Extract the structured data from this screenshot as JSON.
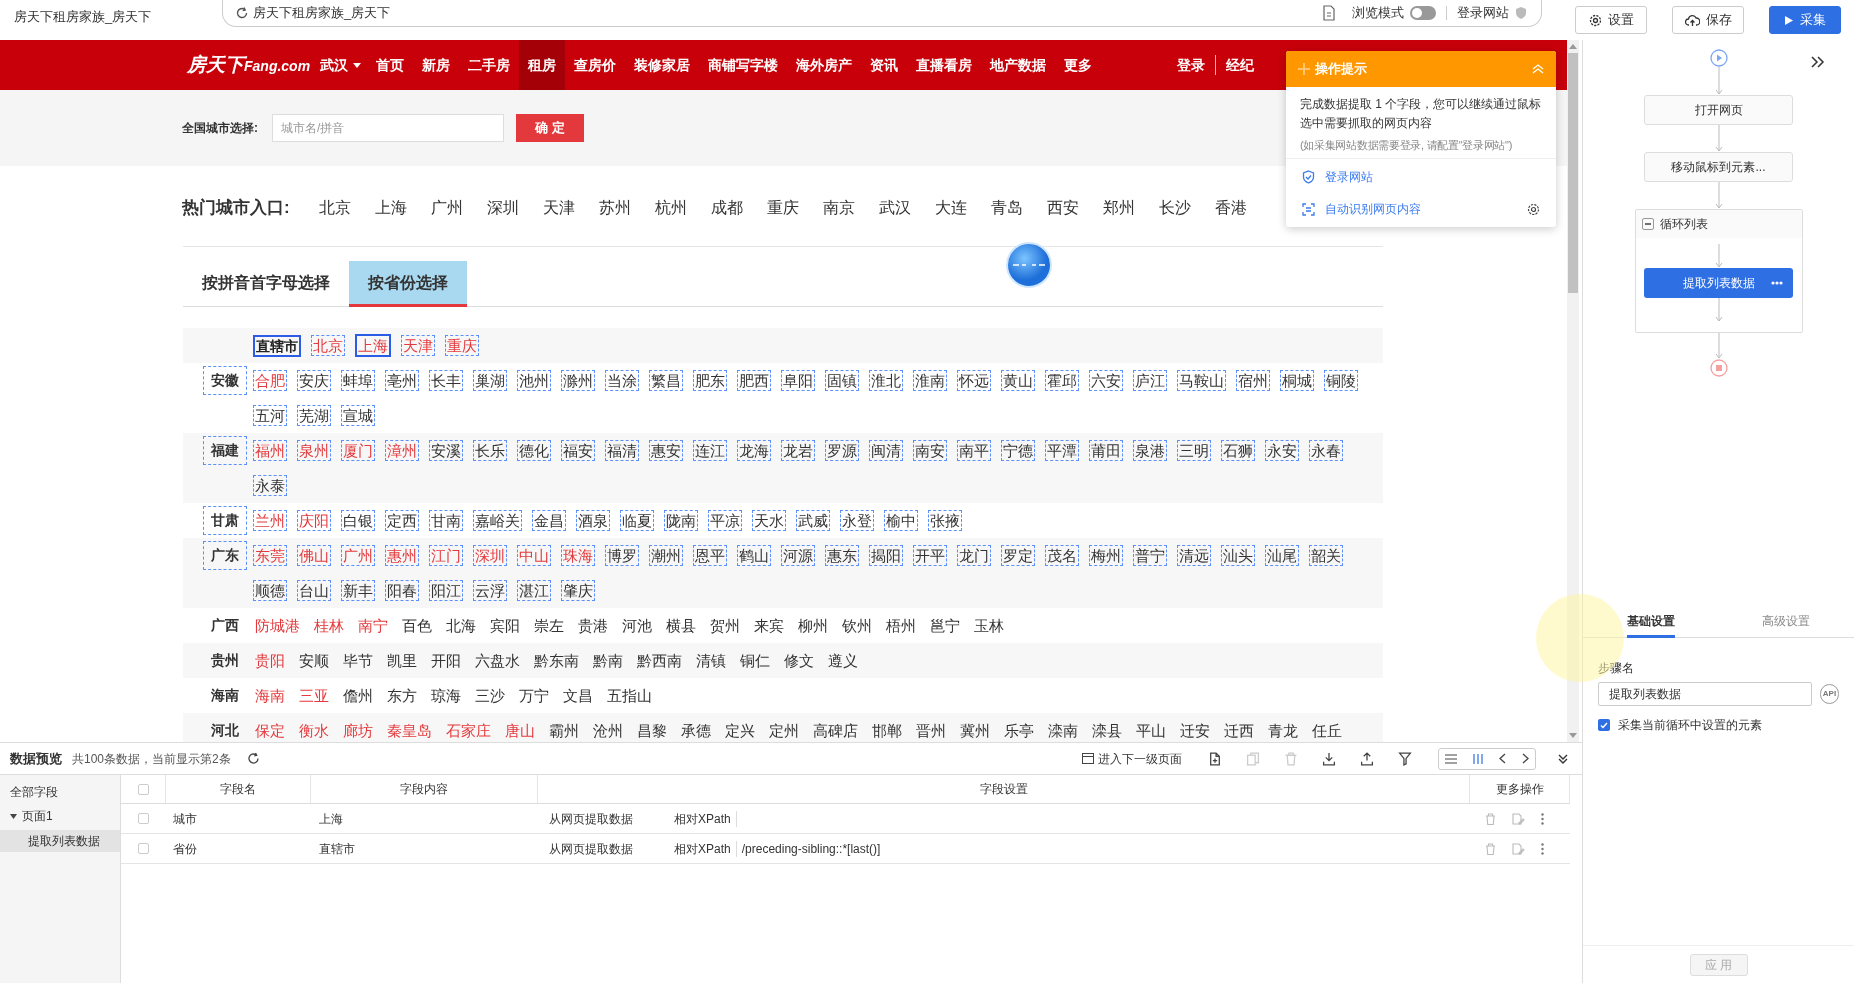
{
  "window": {
    "title": "房天下租房家族_房天下"
  },
  "address_bar": {
    "value": "房天下租房家族_房天下",
    "browse_mode": {
      "label": "浏览模式",
      "on": false
    },
    "login_label": "登录网站"
  },
  "toolbar_buttons": [
    {
      "label": "设置",
      "kind": "settings"
    },
    {
      "label": "保存",
      "kind": "save"
    },
    {
      "label": "采集",
      "kind": "collect"
    }
  ],
  "site": {
    "logo": "房天下",
    "logo_suffix": "Fang.com",
    "city": "武汉",
    "nav": [
      {
        "label": "首页",
        "selected": false
      },
      {
        "label": "新房",
        "selected": false
      },
      {
        "label": "二手房",
        "selected": false
      },
      {
        "label": "租房",
        "selected": true
      },
      {
        "label": "查房价",
        "selected": false
      },
      {
        "label": "装修家居",
        "selected": false
      },
      {
        "label": "商铺写字楼",
        "selected": false
      },
      {
        "label": "海外房产",
        "selected": false
      },
      {
        "label": "资讯",
        "selected": false
      },
      {
        "label": "直播看房",
        "selected": false
      },
      {
        "label": "地产数据",
        "selected": false
      },
      {
        "label": "更多",
        "selected": false
      }
    ],
    "login": "登录",
    "agent": "经纪",
    "city_search": {
      "label": "全国城市选择:",
      "placeholder": "城市名/拼音",
      "button": "确 定"
    },
    "hot_cities": {
      "label": "热门城市入口:",
      "cities": [
        "北京",
        "上海",
        "广州",
        "深圳",
        "天津",
        "苏州",
        "杭州",
        "成都",
        "重庆",
        "南京",
        "武汉",
        "大连",
        "青岛",
        "西安",
        "郑州",
        "长沙",
        "香港"
      ]
    },
    "tabs": [
      {
        "label": "按拼音首字母选择",
        "selected": false
      },
      {
        "label": "按省份选择",
        "selected": true
      }
    ],
    "regions": [
      {
        "name": "直辖市",
        "kind": "municipality",
        "selected": true,
        "outlined": true,
        "cities": [
          {
            "name": "北京",
            "hot": true,
            "selected": false
          },
          {
            "name": "上海",
            "hot": true,
            "selected": true
          },
          {
            "name": "天津",
            "hot": true,
            "selected": false
          },
          {
            "name": "重庆",
            "hot": true,
            "selected": false
          }
        ]
      },
      {
        "name": "安徽",
        "kind": "province",
        "outlined": true,
        "cities": [
          {
            "name": "合肥",
            "hot": true,
            "selected": false
          },
          {
            "name": "安庆",
            "hot": false,
            "selected": false
          },
          {
            "name": "蚌埠",
            "hot": false,
            "selected": false
          },
          {
            "name": "亳州",
            "hot": false,
            "selected": false
          },
          {
            "name": "长丰",
            "hot": false,
            "selected": false
          },
          {
            "name": "巢湖",
            "hot": false,
            "selected": false
          },
          {
            "name": "池州",
            "hot": false,
            "selected": false
          },
          {
            "name": "滁州",
            "hot": false,
            "selected": false
          },
          {
            "name": "当涂",
            "hot": false,
            "selected": false
          },
          {
            "name": "繁昌",
            "hot": false,
            "selected": false
          },
          {
            "name": "肥东",
            "hot": false,
            "selected": false
          },
          {
            "name": "肥西",
            "hot": false,
            "selected": false
          },
          {
            "name": "阜阳",
            "hot": false,
            "selected": false
          },
          {
            "name": "固镇",
            "hot": false,
            "selected": false
          },
          {
            "name": "淮北",
            "hot": false,
            "selected": false
          },
          {
            "name": "淮南",
            "hot": false,
            "selected": false
          },
          {
            "name": "怀远",
            "hot": false,
            "selected": false
          },
          {
            "name": "黄山",
            "hot": false,
            "selected": false
          },
          {
            "name": "霍邱",
            "hot": false,
            "selected": false
          },
          {
            "name": "六安",
            "hot": false,
            "selected": false
          },
          {
            "name": "庐江",
            "hot": false,
            "selected": false
          },
          {
            "name": "马鞍山",
            "hot": false,
            "selected": false
          },
          {
            "name": "宿州",
            "hot": false,
            "selected": false
          },
          {
            "name": "桐城",
            "hot": false,
            "selected": false
          },
          {
            "name": "铜陵",
            "hot": false,
            "selected": false
          },
          {
            "name": "五河",
            "hot": false,
            "selected": false
          },
          {
            "name": "芜湖",
            "hot": false,
            "selected": false
          },
          {
            "name": "宣城",
            "hot": false,
            "selected": false
          }
        ]
      },
      {
        "name": "福建",
        "kind": "province",
        "outlined": true,
        "cities": [
          {
            "name": "福州",
            "hot": true,
            "selected": false
          },
          {
            "name": "泉州",
            "hot": true,
            "selected": false
          },
          {
            "name": "厦门",
            "hot": true,
            "selected": false
          },
          {
            "name": "漳州",
            "hot": true,
            "selected": false
          },
          {
            "name": "安溪",
            "hot": false,
            "selected": false
          },
          {
            "name": "长乐",
            "hot": false,
            "selected": false
          },
          {
            "name": "德化",
            "hot": false,
            "selected": false
          },
          {
            "name": "福安",
            "hot": false,
            "selected": false
          },
          {
            "name": "福清",
            "hot": false,
            "selected": false
          },
          {
            "name": "惠安",
            "hot": false,
            "selected": false
          },
          {
            "name": "连江",
            "hot": false,
            "selected": false
          },
          {
            "name": "龙海",
            "hot": false,
            "selected": false
          },
          {
            "name": "龙岩",
            "hot": false,
            "selected": false
          },
          {
            "name": "罗源",
            "hot": false,
            "selected": false
          },
          {
            "name": "闽清",
            "hot": false,
            "selected": false
          },
          {
            "name": "南安",
            "hot": false,
            "selected": false
          },
          {
            "name": "南平",
            "hot": false,
            "selected": false
          },
          {
            "name": "宁德",
            "hot": false,
            "selected": false
          },
          {
            "name": "平潭",
            "hot": false,
            "selected": false
          },
          {
            "name": "莆田",
            "hot": false,
            "selected": false
          },
          {
            "name": "泉港",
            "hot": false,
            "selected": false
          },
          {
            "name": "三明",
            "hot": false,
            "selected": false
          },
          {
            "name": "石狮",
            "hot": false,
            "selected": false
          },
          {
            "name": "永安",
            "hot": false,
            "selected": false
          },
          {
            "name": "永春",
            "hot": false,
            "selected": false
          },
          {
            "name": "永泰",
            "hot": false,
            "selected": false
          }
        ]
      },
      {
        "name": "甘肃",
        "kind": "province",
        "outlined": true,
        "cities": [
          {
            "name": "兰州",
            "hot": true,
            "selected": false
          },
          {
            "name": "庆阳",
            "hot": true,
            "selected": false
          },
          {
            "name": "白银",
            "hot": false,
            "selected": false
          },
          {
            "name": "定西",
            "hot": false,
            "selected": false
          },
          {
            "name": "甘南",
            "hot": false,
            "selected": false
          },
          {
            "name": "嘉峪关",
            "hot": false,
            "selected": false
          },
          {
            "name": "金昌",
            "hot": false,
            "selected": false
          },
          {
            "name": "酒泉",
            "hot": false,
            "selected": false
          },
          {
            "name": "临夏",
            "hot": false,
            "selected": false
          },
          {
            "name": "陇南",
            "hot": false,
            "selected": false
          },
          {
            "name": "平凉",
            "hot": false,
            "selected": false
          },
          {
            "name": "天水",
            "hot": false,
            "selected": false
          },
          {
            "name": "武威",
            "hot": false,
            "selected": false
          },
          {
            "name": "永登",
            "hot": false,
            "selected": false
          },
          {
            "name": "榆中",
            "hot": false,
            "selected": false
          },
          {
            "name": "张掖",
            "hot": false,
            "selected": false
          }
        ]
      },
      {
        "name": "广东",
        "kind": "province",
        "outlined": true,
        "cities": [
          {
            "name": "东莞",
            "hot": true,
            "selected": false
          },
          {
            "name": "佛山",
            "hot": true,
            "selected": false
          },
          {
            "name": "广州",
            "hot": true,
            "selected": false
          },
          {
            "name": "惠州",
            "hot": true,
            "selected": false
          },
          {
            "name": "江门",
            "hot": true,
            "selected": false
          },
          {
            "name": "深圳",
            "hot": true,
            "selected": false
          },
          {
            "name": "中山",
            "hot": true,
            "selected": false
          },
          {
            "name": "珠海",
            "hot": true,
            "selected": false
          },
          {
            "name": "博罗",
            "hot": false,
            "selected": false
          },
          {
            "name": "潮州",
            "hot": false,
            "selected": false
          },
          {
            "name": "恩平",
            "hot": false,
            "selected": false
          },
          {
            "name": "鹤山",
            "hot": false,
            "selected": false
          },
          {
            "name": "河源",
            "hot": false,
            "selected": false
          },
          {
            "name": "惠东",
            "hot": false,
            "selected": false
          },
          {
            "name": "揭阳",
            "hot": false,
            "selected": false
          },
          {
            "name": "开平",
            "hot": false,
            "selected": false
          },
          {
            "name": "龙门",
            "hot": false,
            "selected": false
          },
          {
            "name": "罗定",
            "hot": false,
            "selected": false
          },
          {
            "name": "茂名",
            "hot": false,
            "selected": false
          },
          {
            "name": "梅州",
            "hot": false,
            "selected": false
          },
          {
            "name": "普宁",
            "hot": false,
            "selected": false
          },
          {
            "name": "清远",
            "hot": false,
            "selected": false
          },
          {
            "name": "汕头",
            "hot": false,
            "selected": false
          },
          {
            "name": "汕尾",
            "hot": false,
            "selected": false
          },
          {
            "name": "韶关",
            "hot": false,
            "selected": false
          },
          {
            "name": "顺德",
            "hot": false,
            "selected": false
          },
          {
            "name": "台山",
            "hot": false,
            "selected": false
          },
          {
            "name": "新丰",
            "hot": false,
            "selected": false
          },
          {
            "name": "阳春",
            "hot": false,
            "selected": false
          },
          {
            "name": "阳江",
            "hot": false,
            "selected": false
          },
          {
            "name": "云浮",
            "hot": false,
            "selected": false
          },
          {
            "name": "湛江",
            "hot": false,
            "selected": false
          },
          {
            "name": "肇庆",
            "hot": false,
            "selected": false
          }
        ]
      },
      {
        "name": "广西",
        "kind": "province",
        "outlined": false,
        "cities": [
          {
            "name": "防城港",
            "hot": true,
            "selected": false
          },
          {
            "name": "桂林",
            "hot": true,
            "selected": false
          },
          {
            "name": "南宁",
            "hot": true,
            "selected": false
          },
          {
            "name": "百色",
            "hot": false,
            "selected": false
          },
          {
            "name": "北海",
            "hot": false,
            "selected": false
          },
          {
            "name": "宾阳",
            "hot": false,
            "selected": false
          },
          {
            "name": "崇左",
            "hot": false,
            "selected": false
          },
          {
            "name": "贵港",
            "hot": false,
            "selected": false
          },
          {
            "name": "河池",
            "hot": false,
            "selected": false
          },
          {
            "name": "横县",
            "hot": false,
            "selected": false
          },
          {
            "name": "贺州",
            "hot": false,
            "selected": false
          },
          {
            "name": "来宾",
            "hot": false,
            "selected": false
          },
          {
            "name": "柳州",
            "hot": false,
            "selected": false
          },
          {
            "name": "钦州",
            "hot": false,
            "selected": false
          },
          {
            "name": "梧州",
            "hot": false,
            "selected": false
          },
          {
            "name": "邕宁",
            "hot": false,
            "selected": false
          },
          {
            "name": "玉林",
            "hot": false,
            "selected": false
          }
        ]
      },
      {
        "name": "贵州",
        "kind": "province",
        "outlined": false,
        "cities": [
          {
            "name": "贵阳",
            "hot": true,
            "selected": false
          },
          {
            "name": "安顺",
            "hot": false,
            "selected": false
          },
          {
            "name": "毕节",
            "hot": false,
            "selected": false
          },
          {
            "name": "凯里",
            "hot": false,
            "selected": false
          },
          {
            "name": "开阳",
            "hot": false,
            "selected": false
          },
          {
            "name": "六盘水",
            "hot": false,
            "selected": false
          },
          {
            "name": "黔东南",
            "hot": false,
            "selected": false
          },
          {
            "name": "黔南",
            "hot": false,
            "selected": false
          },
          {
            "name": "黔西南",
            "hot": false,
            "selected": false
          },
          {
            "name": "清镇",
            "hot": false,
            "selected": false
          },
          {
            "name": "铜仁",
            "hot": false,
            "selected": false
          },
          {
            "name": "修文",
            "hot": false,
            "selected": false
          },
          {
            "name": "遵义",
            "hot": false,
            "selected": false
          }
        ]
      },
      {
        "name": "海南",
        "kind": "province",
        "outlined": false,
        "cities": [
          {
            "name": "海南",
            "hot": true,
            "selected": false
          },
          {
            "name": "三亚",
            "hot": true,
            "selected": false
          },
          {
            "name": "儋州",
            "hot": false,
            "selected": false
          },
          {
            "name": "东方",
            "hot": false,
            "selected": false
          },
          {
            "name": "琼海",
            "hot": false,
            "selected": false
          },
          {
            "name": "三沙",
            "hot": false,
            "selected": false
          },
          {
            "name": "万宁",
            "hot": false,
            "selected": false
          },
          {
            "name": "文昌",
            "hot": false,
            "selected": false
          },
          {
            "name": "五指山",
            "hot": false,
            "selected": false
          }
        ]
      },
      {
        "name": "河北",
        "kind": "province",
        "outlined": false,
        "cities": [
          {
            "name": "保定",
            "hot": true,
            "selected": false
          },
          {
            "name": "衡水",
            "hot": true,
            "selected": false
          },
          {
            "name": "廊坊",
            "hot": true,
            "selected": false
          },
          {
            "name": "秦皇岛",
            "hot": true,
            "selected": false
          },
          {
            "name": "石家庄",
            "hot": true,
            "selected": false
          },
          {
            "name": "唐山",
            "hot": true,
            "selected": false
          },
          {
            "name": "霸州",
            "hot": false,
            "selected": false
          },
          {
            "name": "沧州",
            "hot": false,
            "selected": false
          },
          {
            "name": "昌黎",
            "hot": false,
            "selected": false
          },
          {
            "name": "承德",
            "hot": false,
            "selected": false
          },
          {
            "name": "定兴",
            "hot": false,
            "selected": false
          },
          {
            "name": "定州",
            "hot": false,
            "selected": false
          },
          {
            "name": "高碑店",
            "hot": false,
            "selected": false
          },
          {
            "name": "邯郸",
            "hot": false,
            "selected": false
          },
          {
            "name": "晋州",
            "hot": false,
            "selected": false
          },
          {
            "name": "冀州",
            "hot": false,
            "selected": false
          },
          {
            "name": "乐亭",
            "hot": false,
            "selected": false
          },
          {
            "name": "滦南",
            "hot": false,
            "selected": false
          },
          {
            "name": "滦县",
            "hot": false,
            "selected": false
          },
          {
            "name": "平山",
            "hot": false,
            "selected": false
          },
          {
            "name": "迁安",
            "hot": false,
            "selected": false
          },
          {
            "name": "迁西",
            "hot": false,
            "selected": false
          },
          {
            "name": "青龙",
            "hot": false,
            "selected": false
          },
          {
            "name": "任丘",
            "hot": false,
            "selected": false
          }
        ]
      }
    ]
  },
  "tip_popup": {
    "title": "操作提示",
    "message": "完成数据提取 1 个字段，您可以继续通过鼠标选中需要抓取的网页内容",
    "note": "(如采集网站数据需要登录, 请配置\"登录网站\")",
    "links": [
      {
        "label": "登录网站",
        "kind": "login"
      },
      {
        "label": "自动识别网页内容",
        "kind": "auto_detect"
      }
    ]
  },
  "workflow": {
    "steps": [
      {
        "label": "打开网页",
        "kind": "step",
        "selected": false
      },
      {
        "label": "移动鼠标到元素...",
        "kind": "step",
        "selected": false
      },
      {
        "label": "循环列表",
        "kind": "loop",
        "selected": false,
        "expanded": true,
        "children": [
          {
            "label": "提取列表数据",
            "kind": "step",
            "selected": true
          }
        ]
      }
    ]
  },
  "settings_panel": {
    "tabs": [
      {
        "label": "基础设置",
        "selected": true
      },
      {
        "label": "高级设置",
        "selected": false
      }
    ],
    "step_name_label": "步骤名",
    "step_name": "提取列表数据",
    "api_label": "API",
    "option": {
      "label": "采集当前循环中设置的元素",
      "checked": true
    },
    "apply": {
      "label": "应 用",
      "disabled": true
    }
  },
  "data_preview": {
    "title": "数据预览",
    "summary": "共100条数据，当前显示第2条",
    "next_level": "进入下一级页面",
    "tools": [
      {
        "kind": "add_page",
        "disabled": false
      },
      {
        "kind": "copy",
        "disabled": true
      },
      {
        "kind": "delete",
        "disabled": true
      },
      {
        "kind": "download",
        "disabled": false
      },
      {
        "kind": "upload",
        "disabled": false
      },
      {
        "kind": "filter",
        "disabled": false
      }
    ],
    "tree": [
      {
        "label": "全部字段",
        "selected": false
      },
      {
        "label": "页面1",
        "selected": false,
        "expanded": true,
        "children": [
          {
            "label": "提取列表数据",
            "selected": true
          }
        ]
      }
    ],
    "all_checked": false,
    "columns": [
      "字段名",
      "字段内容",
      "字段设置",
      "更多操作"
    ],
    "rows": [
      {
        "checked": false,
        "name": "城市",
        "content": "上海",
        "source": "从网页提取数据",
        "locator": "相对XPath"
      },
      {
        "checked": false,
        "name": "省份",
        "content": "直辖市",
        "source": "从网页提取数据",
        "locator": "相对XPath",
        "xpath": "/preceding-sibling::*[last()]"
      }
    ]
  }
}
